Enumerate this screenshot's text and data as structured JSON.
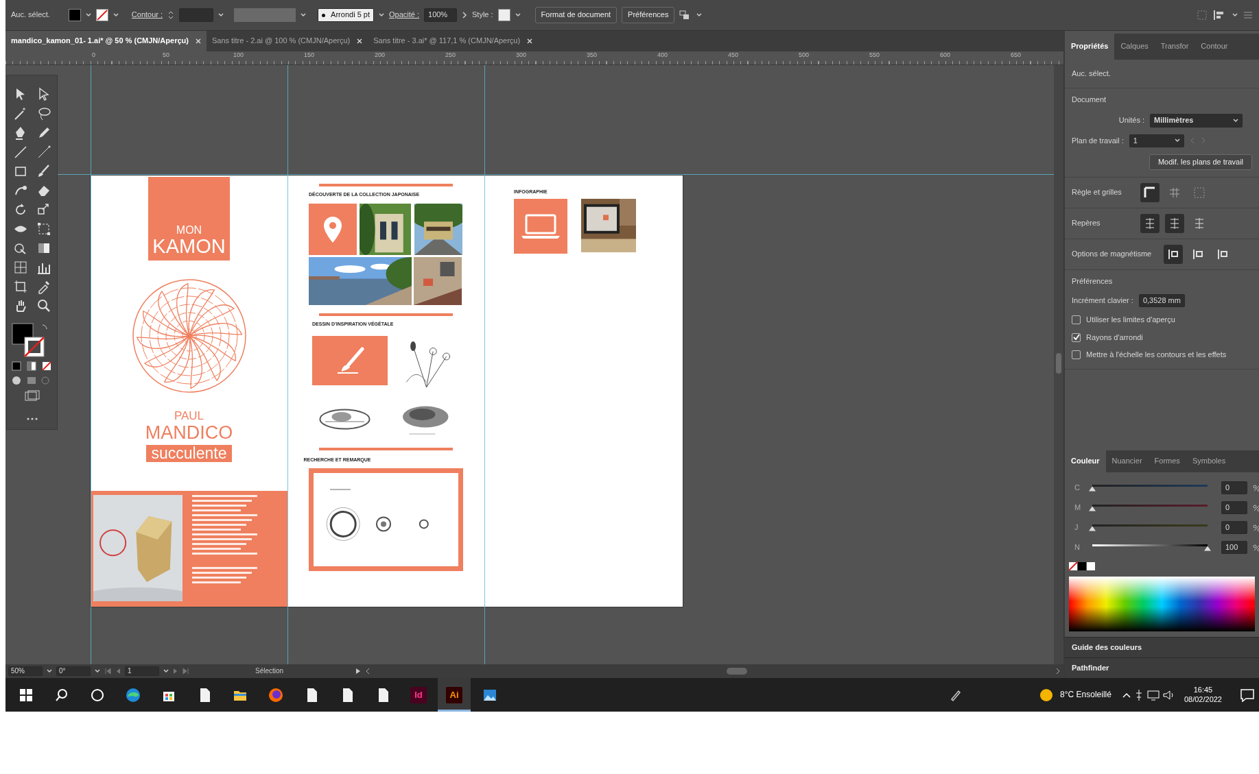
{
  "control_bar": {
    "selection": "Auc. sélect.",
    "stroke_label": "Contour :",
    "brush": "Arrondi 5 pt",
    "opacity_label": "Opacité :",
    "opacity": "100%",
    "style_label": "Style :",
    "buttons": [
      "Format de document",
      "Préférences"
    ]
  },
  "doc_tabs": [
    {
      "label": "mandico_kamon_01- 1.ai* @ 50 % (CMJN/Aperçu)",
      "selected": true
    },
    {
      "label": "Sans titre - 2.ai @ 100 % (CMJN/Aperçu)",
      "selected": false
    },
    {
      "label": "Sans titre - 3.ai* @ 117,1 % (CMJN/Aperçu)",
      "selected": false
    }
  ],
  "ruler_ticks": [
    "0",
    "50",
    "100",
    "150",
    "200",
    "250",
    "300",
    "350",
    "400",
    "450",
    "500",
    "550",
    "600",
    "650"
  ],
  "artboard": {
    "cover": {
      "line1": "MON",
      "line2": "KAMON",
      "first_name": "PAUL",
      "last_name": "MANDICO",
      "tag": "succulente"
    },
    "sections": [
      "DÉCOUVERTE DE LA COLLECTION JAPONAISE",
      "DESSIN D'INSPIRATION VÉGÉTALE",
      "RECHERCHE ET REMARQUE"
    ],
    "third_heading": "INFOGRAPHIE"
  },
  "panel_tabs": [
    {
      "label": "Propriétés",
      "selected": true
    },
    {
      "label": "Calques",
      "selected": false
    },
    {
      "label": "Transfor",
      "selected": false
    },
    {
      "label": "Contour",
      "selected": false
    }
  ],
  "properties": {
    "selection": "Auc. sélect.",
    "document_heading": "Document",
    "units_label": "Unités :",
    "units": "Millimètres",
    "artboard_label": "Plan de travail :",
    "artboard": "1",
    "edit_button": "Modif. les plans de travail",
    "rulers_label": "Règle et grilles",
    "guides_label": "Repères",
    "snap_label": "Options de magnétisme",
    "prefs_heading": "Préférences",
    "increment_label": "Incrément clavier :",
    "increment": "0,3528 mm",
    "options": [
      {
        "label": "Utiliser les limites d'aperçu",
        "checked": false
      },
      {
        "label": "Rayons d'arrondi",
        "checked": true
      },
      {
        "label": "Mettre à l'échelle les contours et les effets",
        "checked": false
      }
    ]
  },
  "color_panel": {
    "tabs": [
      {
        "label": "Couleur",
        "selected": true
      },
      {
        "label": "Nuancier",
        "selected": false
      },
      {
        "label": "Formes",
        "selected": false
      },
      {
        "label": "Symboles",
        "selected": false
      }
    ],
    "channels": [
      {
        "name": "C",
        "value": "0",
        "level": 0
      },
      {
        "name": "M",
        "value": "0",
        "level": 0
      },
      {
        "name": "J",
        "value": "0",
        "level": 0
      },
      {
        "name": "N",
        "value": "100",
        "level": 1
      }
    ]
  },
  "collapsed_panels": [
    "Guide des couleurs",
    "Pathfinder"
  ],
  "status_bar": {
    "zoom": "50%",
    "rotation": "0°",
    "artboard": "1",
    "tool": "Sélection"
  },
  "taskbar": {
    "apps": [
      {
        "label": "Id",
        "active": false
      },
      {
        "label": "Ai",
        "active": true
      }
    ],
    "weather": "8°C Ensoleillé",
    "time": "16:45",
    "date": "08/02/2022"
  }
}
